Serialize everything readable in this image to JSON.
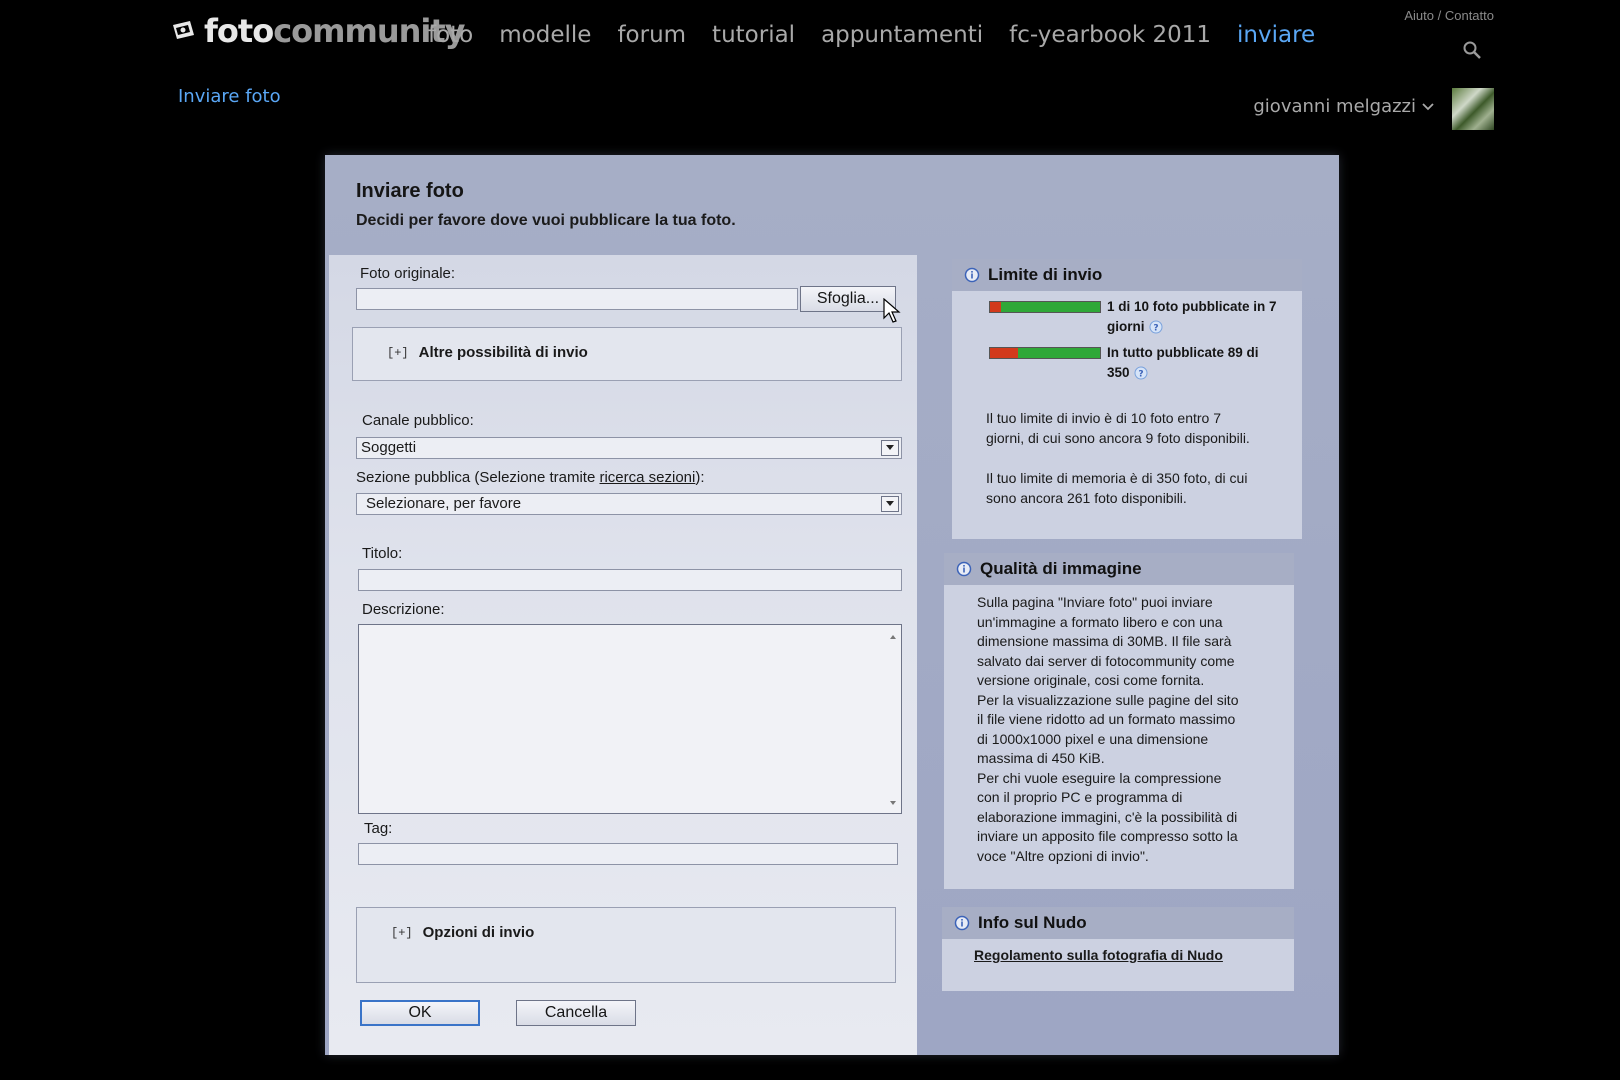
{
  "header": {
    "logo_a": "foto",
    "logo_b": "community",
    "nav": [
      "foto",
      "modelle",
      "forum",
      "tutorial",
      "appuntamenti",
      "fc-yearbook 2011",
      "inviare"
    ],
    "active_nav": "inviare",
    "help": "Aiuto / Contatto",
    "subnav": "Inviare foto",
    "user": "giovanni melgazzi",
    "accent_color": "#5aa7f5"
  },
  "dialog": {
    "title": "Inviare foto",
    "subtitle": "Decidi per favore dove vuoi pubblicare la tua foto.",
    "form": {
      "original_label": "Foto originale:",
      "original_value": "",
      "browse_button": "Sfoglia...",
      "more_options": "Altre possibilità di invio",
      "expander_symbol": "[+]",
      "channel_label": "Canale pubblico:",
      "channel_value": "Soggetti",
      "section_label_pre": "Sezione pubblica (Selezione tramite ",
      "section_label_link": "ricerca sezioni",
      "section_label_post": "):",
      "section_value": "Selezionare, per favore",
      "title_label": "Titolo:",
      "title_value": "",
      "description_label": "Descrizione:",
      "description_value": "",
      "tag_label": "Tag:",
      "tag_value": "",
      "send_options": "Opzioni di invio",
      "ok_button": "OK",
      "cancel_button": "Cancella"
    },
    "limits": {
      "title": "Limite di invio",
      "bar1_fraction": 0.1,
      "bar1_line1": "1 di 10 foto pubblicate in 7",
      "bar1_line2": "giorni",
      "bar2_fraction": 0.254,
      "bar2_line1": "In tutto pubblicate 89 di",
      "bar2_line2": "350",
      "text1_line1": "Il tuo limite di invio è di 10 foto entro 7",
      "text1_line2": "giorni, di cui sono ancora 9 foto disponibili.",
      "text2_line1": "Il tuo limite di memoria è di 350 foto, di cui",
      "text2_line2": "sono ancora 261 foto disponibili."
    },
    "quality": {
      "title": "Qualità di immagine",
      "lines": [
        "Sulla pagina \"Inviare foto\" puoi inviare",
        "un'immagine a formato libero e con una",
        "dimensione massima di 30MB. Il file sarà",
        "salvato dai server di fotocommunity come",
        "versione originale, cosi come fornita.",
        "Per la visualizzazione sulle pagine del sito",
        "il file viene ridotto ad un formato massimo",
        "di 1000x1000 pixel e una dimensione",
        "massima di 450 KiB.",
        "Per chi vuole eseguire la compressione",
        "con il proprio PC e programma di",
        "elaborazione immagini, c'è la possibilità di",
        "inviare un apposito file compresso sotto la",
        "voce \"Altre opzioni di invio\"."
      ]
    },
    "nude": {
      "title": "Info sul Nudo",
      "link": "Regolamento sulla fotografia di Nudo"
    }
  }
}
